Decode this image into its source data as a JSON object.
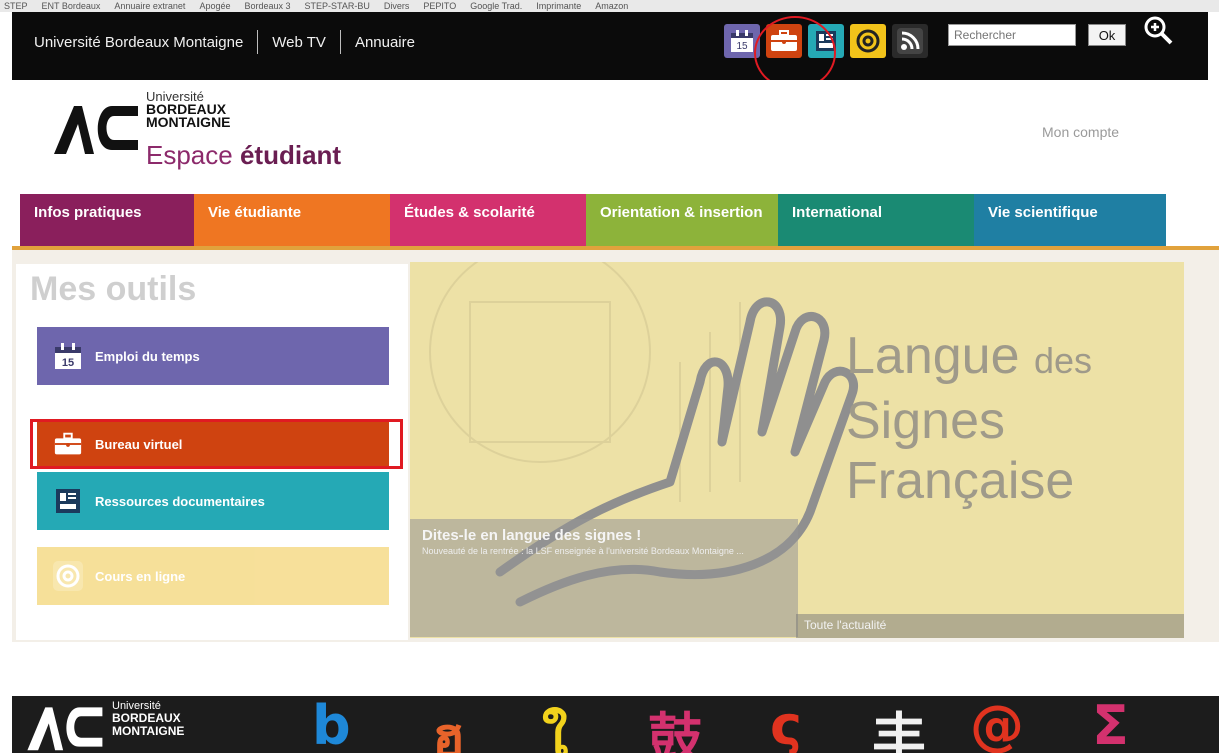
{
  "bookmarks": [
    "STEP",
    "ENT Bordeaux",
    "Annuaire extranet",
    "Apogée",
    "Bordeaux 3",
    "STEP-STAR-BU",
    "Divers",
    "PEPITO",
    "Google Trad.",
    "Imprimante",
    "Amazon"
  ],
  "topbar": {
    "links": [
      "Université Bordeaux Montaigne",
      "Web TV",
      "Annuaire"
    ],
    "icons": [
      "calendar-icon",
      "briefcase-icon",
      "documents-icon",
      "at-mail-icon",
      "rss-icon"
    ],
    "search_placeholder": "Rechercher",
    "ok_label": "Ok",
    "calendar_day": "15"
  },
  "header": {
    "logo_line1": "Université",
    "logo_line2": "BORDEAUX",
    "logo_line3": "MONTAIGNE",
    "espace_prefix": "Espace",
    "espace_bold": "étudiant",
    "account_link": "Mon compte"
  },
  "nav": [
    {
      "label": "Infos pratiques",
      "color": "#8a1f5c"
    },
    {
      "label": "Vie étudiante",
      "color": "#ef7622"
    },
    {
      "label": "Études & scolarité",
      "color": "#d3316e"
    },
    {
      "label": "Orientation & insertion",
      "color": "#8db33a"
    },
    {
      "label": "International",
      "color": "#1a8a73"
    },
    {
      "label": "Vie scientifique",
      "color": "#1f7fa3"
    }
  ],
  "tools": {
    "title": "Mes outils",
    "items": [
      {
        "label": "Emploi du temps",
        "color": "#6e66ad",
        "icon": "calendar-icon",
        "day": "15"
      },
      {
        "label": "Bureau virtuel",
        "color": "#cf4310",
        "icon": "briefcase-icon"
      },
      {
        "label": "Ressources documentaires",
        "color": "#25a9b5",
        "icon": "documents-icon"
      },
      {
        "label": "Cours en ligne",
        "color": "#f3d36f",
        "icon": "at-mail-icon"
      }
    ]
  },
  "banner": {
    "line1": "Langue",
    "line1_small": "des",
    "line2": "Signes",
    "line3": "Française",
    "caption_title": "Dites-le en langue des signes !",
    "caption_text": "Nouveauté de la rentrée : la LSF enseignée à l'université Bordeaux Montaigne ...",
    "all_news": "Toute l'actualité"
  },
  "footer": {
    "logo_line1": "Université",
    "logo_line2": "BORDEAUX",
    "logo_line3": "MONTAIGNE",
    "glyphs": [
      "b",
      "ฮ",
      "ใ",
      "鼓",
      "ς",
      "丰",
      "@",
      "Σ"
    ]
  }
}
